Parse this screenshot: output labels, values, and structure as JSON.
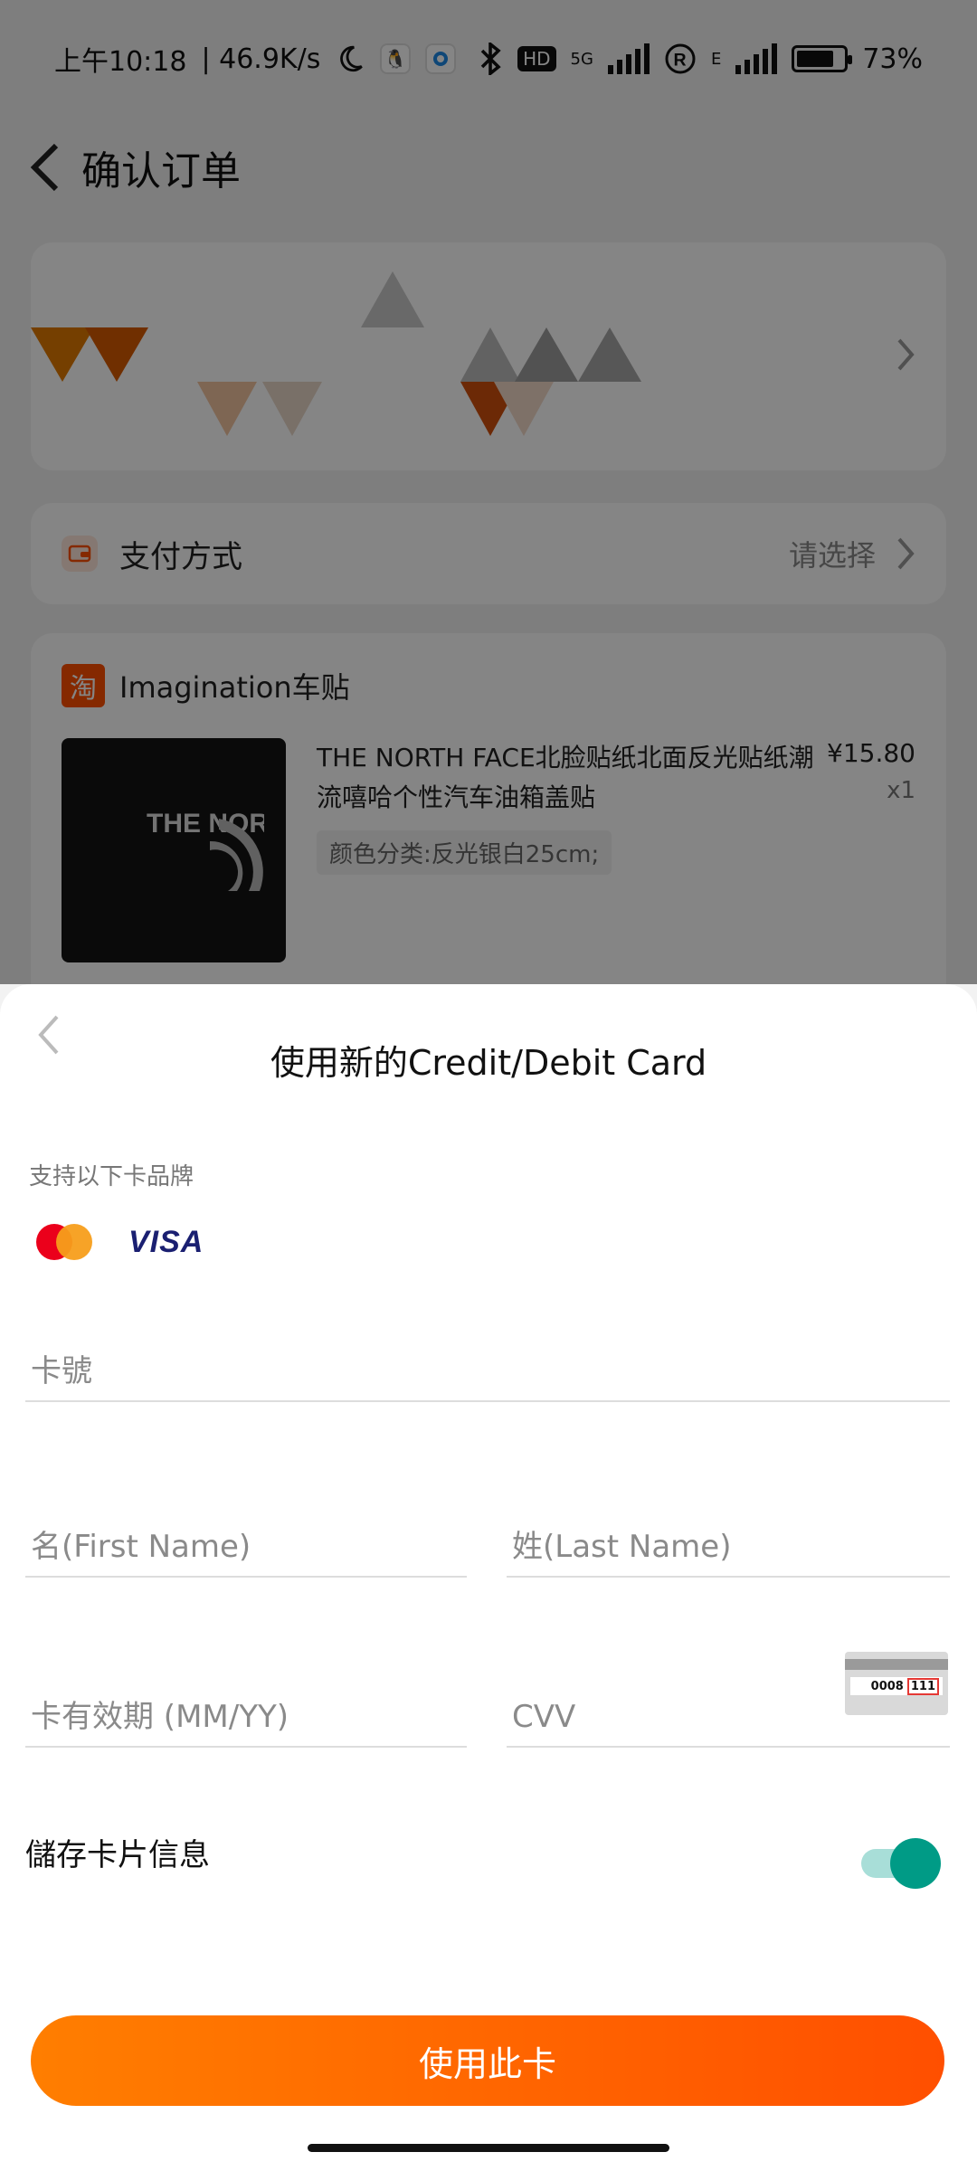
{
  "status_bar": {
    "time": "上午10:18",
    "net_speed": "| 46.9K/s",
    "network_5g": "5G",
    "hd": "HD",
    "network_e": "E",
    "battery": "73%"
  },
  "header": {
    "title": "确认订单"
  },
  "payment_row": {
    "label": "支付方式",
    "value": "请选择"
  },
  "order": {
    "shop_logo": "淘",
    "shop_name": "Imagination车贴",
    "product_title": "THE NORTH FACE北脸贴纸北面反光贴纸潮流嘻哈个性汽车油箱盖贴",
    "sku": "颜色分类:反光银白25cm;",
    "price": "¥15.80",
    "quantity": "x1",
    "image_text": "THE NORTH FACE"
  },
  "card_sheet": {
    "title": "使用新的Credit/Debit Card",
    "brands_label": "支持以下卡品牌",
    "brands": [
      "mastercard",
      "VISA"
    ],
    "card_number_placeholder": "卡號",
    "first_name_placeholder": "名(First Name)",
    "last_name_placeholder": "姓(Last Name)",
    "expiry_placeholder": "卡有效期 (MM/YY)",
    "cvv_placeholder": "CVV",
    "cvv_hint_number": "0008",
    "cvv_hint_code": "111",
    "save_card_label": "儲存卡片信息",
    "save_card_enabled": true,
    "submit_label": "使用此卡"
  },
  "colors": {
    "accent": "#ff6a00",
    "toggle_on": "#009b86",
    "shop_logo": "#ff5000"
  }
}
